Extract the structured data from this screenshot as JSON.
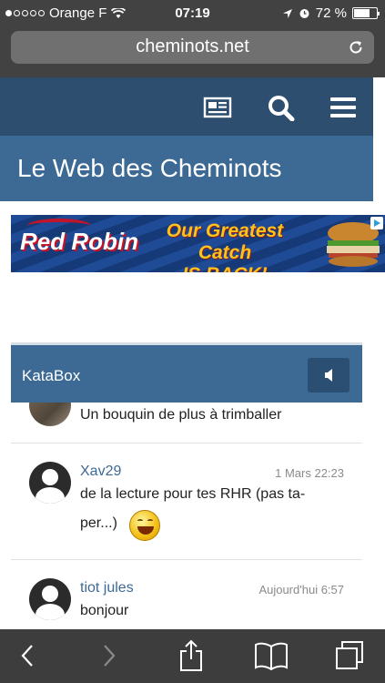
{
  "status_bar": {
    "carrier": "Orange F",
    "time": "07:19",
    "battery": "72 %",
    "battery_level": 0.72,
    "signal_dots_filled": 1,
    "signal_dots_total": 5
  },
  "browser": {
    "url": "cheminots.net"
  },
  "site": {
    "title": "Le Web des Cheminots"
  },
  "ad": {
    "brand": "Red Robin",
    "headline_line1": "Our Greatest Catch",
    "headline_line2": "IS BACK!"
  },
  "katabox": {
    "title": "KataBox",
    "messages": [
      {
        "author": "",
        "time": "",
        "text": "Un bouquin de plus à trimballer"
      },
      {
        "author": "Xav29",
        "time": "1 Mars 22:23",
        "text_line1": "de la lecture pour tes RHR (pas ta-",
        "text_line2": "per...)"
      },
      {
        "author": "tiot jules",
        "time": "Aujourd'hui 6:57",
        "text": "bonjour"
      }
    ]
  },
  "colors": {
    "nav_dark": "#2d4e6e",
    "nav_mid": "#3c6a94",
    "author_link": "#3d6a95",
    "ios_chrome": "#424242"
  }
}
